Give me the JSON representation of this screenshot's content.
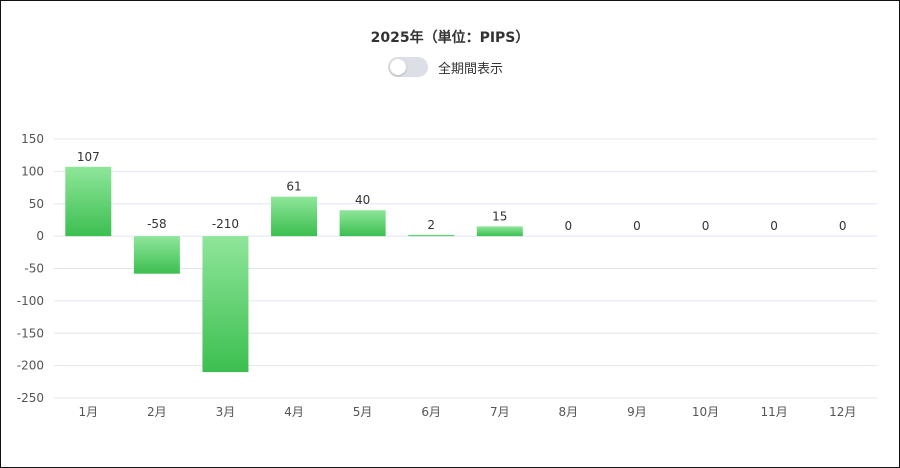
{
  "header": {
    "title": "2025年（単位：PIPS）",
    "toggle_label": "全期間表示",
    "toggle_on": false
  },
  "colors": {
    "bar_top": "#8fe69a",
    "bar_bottom": "#3cbf50",
    "grid": "#e0e6f1",
    "toggle_off": "#dcdfe6"
  },
  "chart_data": {
    "type": "bar",
    "categories": [
      "1月",
      "2月",
      "3月",
      "4月",
      "5月",
      "6月",
      "7月",
      "8月",
      "9月",
      "10月",
      "11月",
      "12月"
    ],
    "values": [
      107,
      -58,
      -210,
      61,
      40,
      2,
      15,
      0,
      0,
      0,
      0,
      0
    ],
    "ylim": [
      -250,
      150
    ],
    "yticks": [
      150,
      100,
      50,
      0,
      -50,
      -100,
      -150,
      -200,
      -250
    ],
    "grid": true,
    "legend": "none"
  }
}
